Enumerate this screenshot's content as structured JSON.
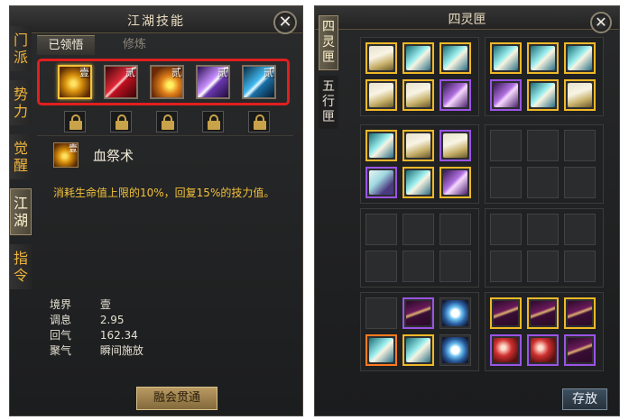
{
  "left_panel": {
    "title": "江湖技能",
    "close_label": "✕",
    "side_tabs": [
      {
        "label": "门派"
      },
      {
        "label": "势力"
      },
      {
        "label": "觉醒"
      },
      {
        "label": "江湖",
        "active": true
      },
      {
        "label": "指令"
      }
    ],
    "sub_tabs": [
      {
        "label": "已领悟",
        "active": true
      },
      {
        "label": "修炼"
      }
    ],
    "skills": [
      {
        "badge": "壹",
        "icon": "blood-swirl-icon",
        "color": "#c88a10",
        "selected": true
      },
      {
        "badge": "贰",
        "icon": "crossed-swords-icon",
        "color": "#c0162a"
      },
      {
        "badge": "贰",
        "icon": "flame-fist-icon",
        "color": "#b54a10"
      },
      {
        "badge": "贰",
        "icon": "purple-crystal-icon",
        "color": "#8a4bd6"
      },
      {
        "badge": "贰",
        "icon": "blue-slash-icon",
        "color": "#1a8ac8"
      }
    ],
    "selected_skill": {
      "name": "血祭术",
      "badge": "壹",
      "description": "消耗生命值上限的10%，回复15%的技力值。"
    },
    "stats": [
      {
        "key": "境界",
        "value": "壹"
      },
      {
        "key": "调息",
        "value": "2.95"
      },
      {
        "key": "回气",
        "value": "162.34"
      },
      {
        "key": "聚气",
        "value": "瞬间施放"
      }
    ],
    "master_button": "融会贯通"
  },
  "right_panel": {
    "title": "四灵匣",
    "close_label": "✕",
    "tabs": [
      {
        "label": "四灵匣",
        "active": true
      },
      {
        "label": "五行匣"
      }
    ],
    "store_button": "存放",
    "item_groups": [
      {
        "items": [
          {
            "quality": "gold",
            "type": "scroll"
          },
          {
            "quality": "gold",
            "type": "cyan"
          },
          {
            "quality": "gold",
            "type": "cyan"
          },
          {
            "quality": "gold",
            "type": "scroll"
          },
          {
            "quality": "gold",
            "type": "scroll"
          },
          {
            "quality": "purple",
            "type": "purple"
          }
        ]
      },
      {
        "items": [
          {
            "quality": "gold",
            "type": "cyan"
          },
          {
            "quality": "gold",
            "type": "cyan"
          },
          {
            "quality": "gold",
            "type": "cyan"
          },
          {
            "quality": "purple",
            "type": "purple"
          },
          {
            "quality": "gold",
            "type": "cyan"
          },
          {
            "quality": "gold",
            "type": "scroll"
          }
        ]
      },
      {
        "items": [
          {
            "quality": "gold",
            "type": "cyan"
          },
          {
            "quality": "gold",
            "type": "scroll"
          },
          {
            "quality": "purple",
            "type": "scroll"
          },
          {
            "quality": "purple",
            "type": "shoe"
          },
          {
            "quality": "gold",
            "type": "cyan"
          },
          {
            "quality": "gold",
            "type": "purple"
          }
        ]
      },
      {
        "items": [
          {
            "quality": "empty"
          },
          {
            "quality": "empty"
          },
          {
            "quality": "empty"
          },
          {
            "quality": "empty"
          },
          {
            "quality": "empty"
          },
          {
            "quality": "empty"
          }
        ]
      },
      {
        "items": [
          {
            "quality": "empty"
          },
          {
            "quality": "empty"
          },
          {
            "quality": "empty"
          },
          {
            "quality": "empty"
          },
          {
            "quality": "empty"
          },
          {
            "quality": "empty"
          }
        ]
      },
      {
        "items": [
          {
            "quality": "empty"
          },
          {
            "quality": "empty"
          },
          {
            "quality": "empty"
          },
          {
            "quality": "empty"
          },
          {
            "quality": "empty"
          },
          {
            "quality": "empty"
          }
        ]
      },
      {
        "items": [
          {
            "quality": "empty"
          },
          {
            "quality": "purple",
            "type": "blade"
          },
          {
            "quality": "none",
            "type": "ring"
          },
          {
            "quality": "orange",
            "type": "cyan"
          },
          {
            "quality": "gold",
            "type": "cyan"
          },
          {
            "quality": "none",
            "type": "ring"
          }
        ]
      },
      {
        "items": [
          {
            "quality": "gold",
            "type": "blade"
          },
          {
            "quality": "gold",
            "type": "blade"
          },
          {
            "quality": "gold",
            "type": "blade"
          },
          {
            "quality": "purple",
            "type": "red"
          },
          {
            "quality": "purple",
            "type": "red"
          },
          {
            "quality": "purple",
            "type": "blade"
          }
        ]
      }
    ]
  },
  "colors": {
    "accent_gold": "#f2c23a",
    "highlight_red": "#e11f1f",
    "quality_gold": "#f0b828",
    "quality_purple": "#9a54e4",
    "quality_orange": "#ff7a1e"
  }
}
